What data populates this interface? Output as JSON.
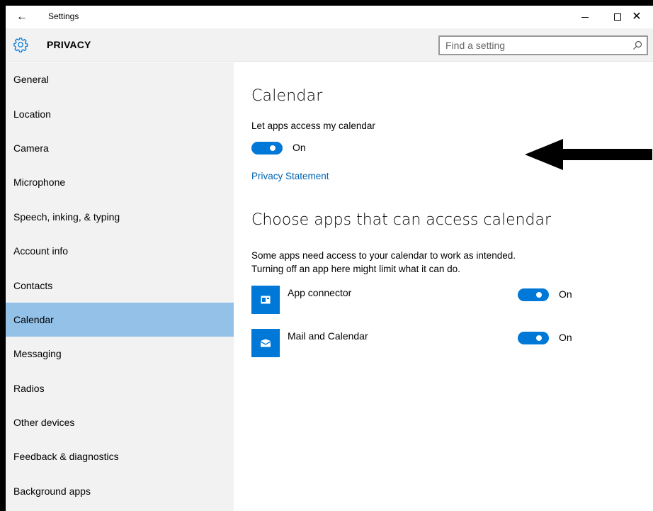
{
  "titlebar": {
    "back_icon": "back-arrow-icon",
    "title": "Settings",
    "minimize_icon": "minimize-icon",
    "maximize_icon": "maximize-icon",
    "close_icon": "close-icon"
  },
  "header": {
    "icon": "gear-icon",
    "title": "PRIVACY",
    "search": {
      "placeholder": "Find a setting",
      "value": "",
      "icon": "search-icon"
    }
  },
  "sidebar": {
    "items": [
      {
        "label": "General",
        "selected": false
      },
      {
        "label": "Location",
        "selected": false
      },
      {
        "label": "Camera",
        "selected": false
      },
      {
        "label": "Microphone",
        "selected": false
      },
      {
        "label": "Speech, inking, & typing",
        "selected": false
      },
      {
        "label": "Account info",
        "selected": false
      },
      {
        "label": "Contacts",
        "selected": false
      },
      {
        "label": "Calendar",
        "selected": true
      },
      {
        "label": "Messaging",
        "selected": false
      },
      {
        "label": "Radios",
        "selected": false
      },
      {
        "label": "Other devices",
        "selected": false
      },
      {
        "label": "Feedback & diagnostics",
        "selected": false
      },
      {
        "label": "Background apps",
        "selected": false
      }
    ]
  },
  "main": {
    "title": "Calendar",
    "access_label": "Let apps access my calendar",
    "access_toggle": {
      "state": "On",
      "on": true
    },
    "privacy_link": "Privacy Statement",
    "subheading": "Choose apps that can access calendar",
    "description_line1": "Some apps need access to your calendar to work as intended.",
    "description_line2": "Turning off an app here might limit what it can do.",
    "apps": [
      {
        "name": "App connector",
        "icon": "app-connector-icon",
        "toggle": "On",
        "on": true
      },
      {
        "name": "Mail and Calendar",
        "icon": "mail-envelope-icon",
        "toggle": "On",
        "on": true
      }
    ]
  },
  "colors": {
    "accent": "#0078d7",
    "selected_nav": "#94c1e8",
    "sidebar_bg": "#f2f2f2",
    "link": "#0063b1",
    "annotation": "#000000"
  },
  "annotation": {
    "icon": "left-arrow-annotation"
  }
}
